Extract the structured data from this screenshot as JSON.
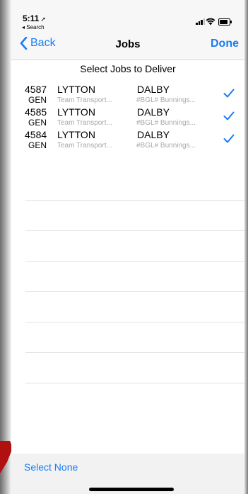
{
  "status_bar": {
    "time": "5:11",
    "location_glyph": "➚",
    "back_app": "◂ Search"
  },
  "nav": {
    "back_label": "Back",
    "title": "Jobs",
    "done_label": "Done"
  },
  "subheader": "Select Jobs to Deliver",
  "jobs": [
    {
      "number": "4587",
      "code": "GEN",
      "from": "LYTTON",
      "from_sub": "Team Transport...",
      "to": "DALBY",
      "to_sub": "#BGL# Bunnings...",
      "selected": true
    },
    {
      "number": "4585",
      "code": "GEN",
      "from": "LYTTON",
      "from_sub": "Team Transport...",
      "to": "DALBY",
      "to_sub": "#BGL# Bunnings...",
      "selected": true
    },
    {
      "number": "4584",
      "code": "GEN",
      "from": "LYTTON",
      "from_sub": "Team Transport...",
      "to": "DALBY",
      "to_sub": "#BGL# Bunnings...",
      "selected": true
    }
  ],
  "toolbar": {
    "select_none_label": "Select None"
  },
  "colors": {
    "accent": "#1a7cf5",
    "annotation_arrow": "#b01010"
  },
  "icons": {
    "back": "chevron-left-icon",
    "check": "checkmark-icon",
    "signal": "cellular-signal-icon",
    "wifi": "wifi-icon",
    "battery": "battery-icon"
  }
}
